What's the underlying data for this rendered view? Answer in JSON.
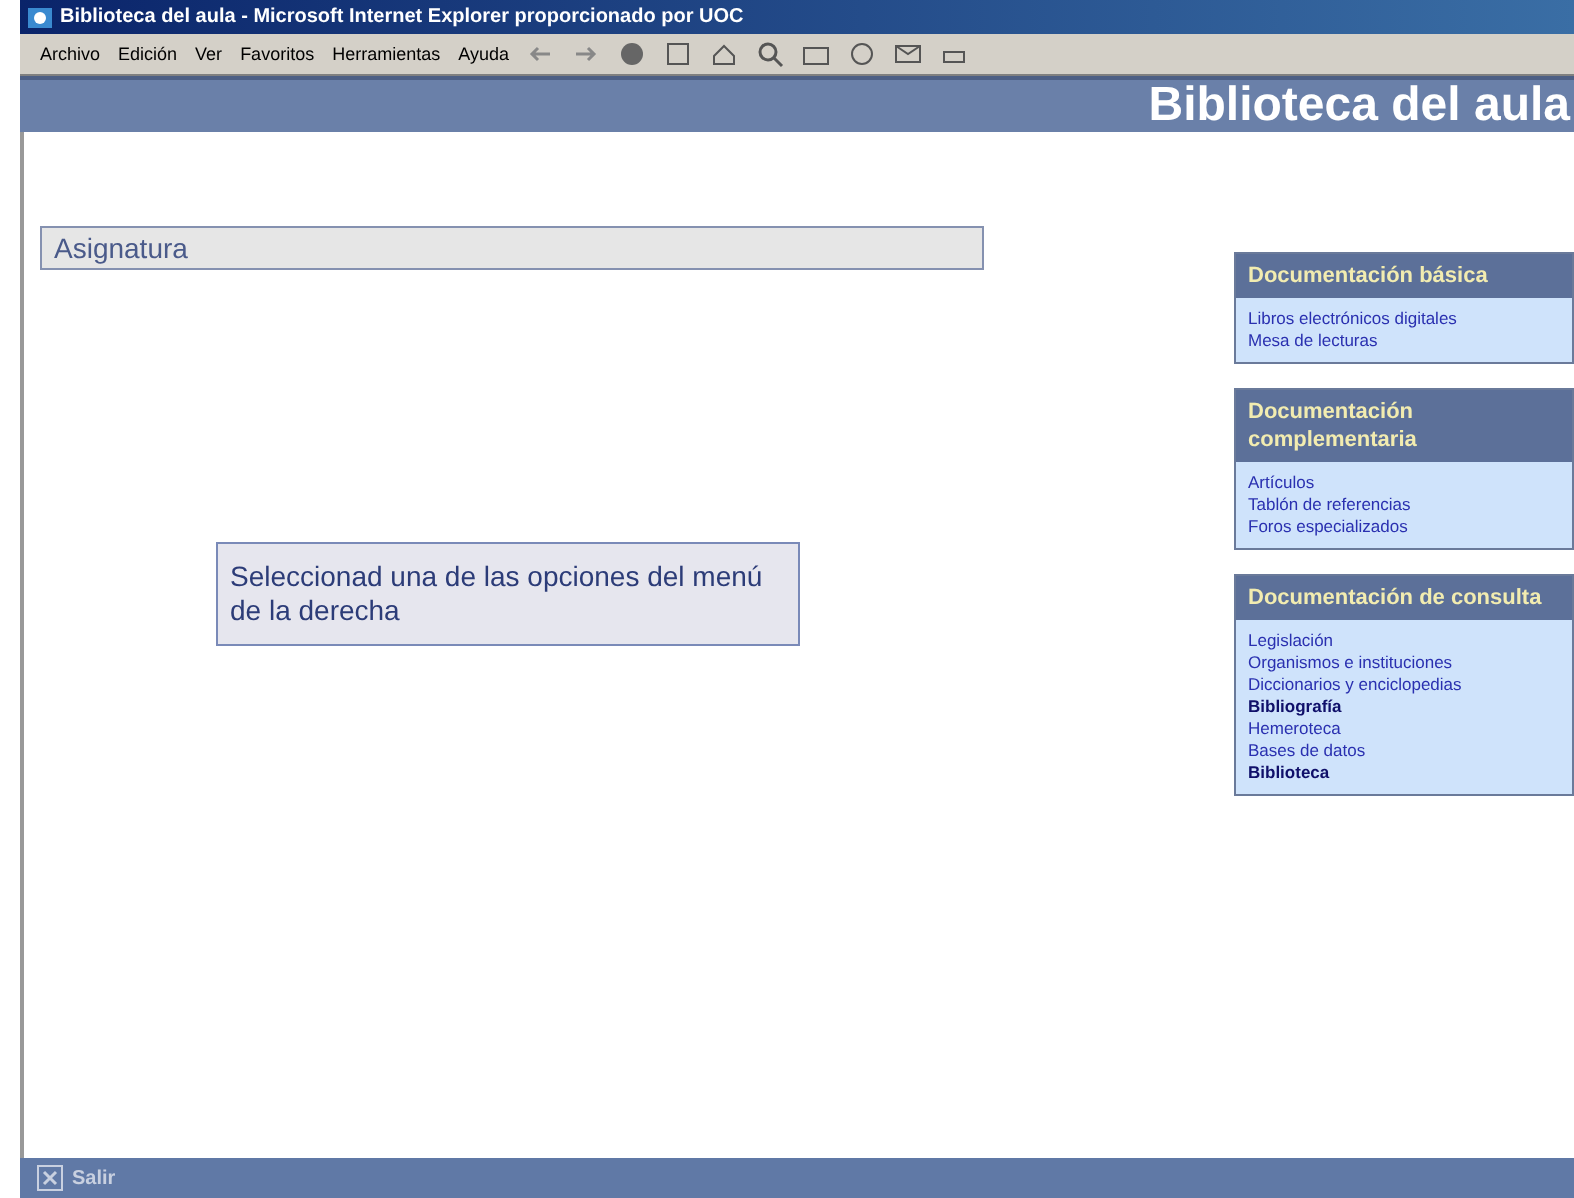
{
  "window": {
    "title": "Biblioteca del aula - Microsoft Internet Explorer proporcionado por UOC"
  },
  "menu": [
    "Archivo",
    "Edición",
    "Ver",
    "Favoritos",
    "Herramientas",
    "Ayuda"
  ],
  "header": {
    "title": "Biblioteca del aula"
  },
  "subject": {
    "label": "Asignatura"
  },
  "message": "Seleccionad una de las opciones del menú de la derecha",
  "panels": [
    {
      "title": "Documentación básica",
      "links": [
        {
          "label": "Libros electrónicos digitales",
          "visited": false
        },
        {
          "label": "Mesa de lecturas",
          "visited": false
        }
      ]
    },
    {
      "title": "Documentación complementaria",
      "links": [
        {
          "label": "Artículos",
          "visited": false
        },
        {
          "label": "Tablón de referencias",
          "visited": false
        },
        {
          "label": "Foros especializados",
          "visited": false
        }
      ]
    },
    {
      "title": "Documentación de consulta",
      "links": [
        {
          "label": "Legislación",
          "visited": false
        },
        {
          "label": "Organismos e instituciones",
          "visited": false
        },
        {
          "label": "Diccionarios y enciclopedias",
          "visited": false
        },
        {
          "label": "Bibliografía",
          "visited": true
        },
        {
          "label": "Hemeroteca",
          "visited": false
        },
        {
          "label": "Bases de datos",
          "visited": false
        },
        {
          "label": "Biblioteca",
          "visited": true
        }
      ]
    }
  ],
  "footer": {
    "exit": "Salir"
  }
}
